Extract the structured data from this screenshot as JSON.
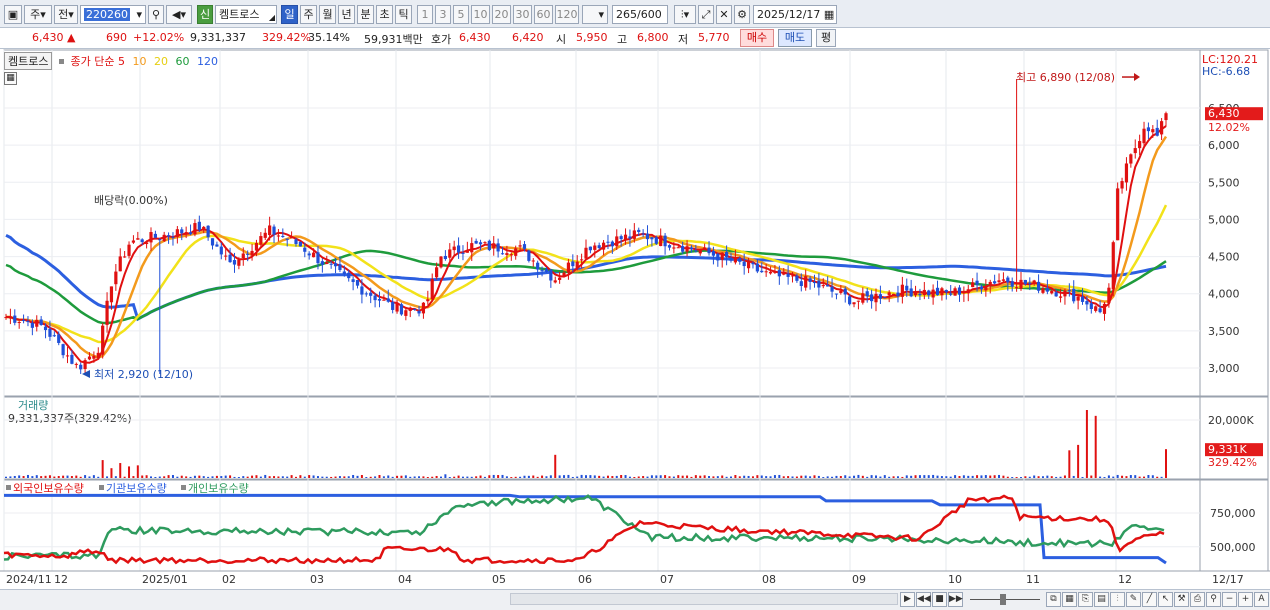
{
  "toolbar": {
    "period_label": "주",
    "prev_label": "전",
    "stock_code": "220260",
    "credit_badge": "신",
    "stock_name": "켐트로스",
    "tabs": [
      "일",
      "주",
      "월",
      "년",
      "분",
      "초",
      "틱"
    ],
    "active_tab": "일",
    "intervals": [
      "1",
      "3",
      "5",
      "10",
      "20",
      "30",
      "60",
      "120"
    ],
    "count": "265",
    "count_total": "/600",
    "date": "2025/12/17"
  },
  "quote": {
    "price": "6,430",
    "change": "690",
    "change_pct": "+12.02%",
    "volume": "9,331,337",
    "volume_ratio": "329.42%",
    "turnover": "35.14%",
    "amount": "59,931백만",
    "ask_label": "호가",
    "ask": "6,430",
    "bid": "6,420",
    "open_label": "시",
    "open": "5,950",
    "high_label": "고",
    "high": "6,800",
    "low_label": "저",
    "low": "5,770",
    "buy_label": "매수",
    "sell_label": "매도",
    "eval_label": "평"
  },
  "legend": {
    "stock_name": "켐트로스",
    "ma_title": "종가 단순",
    "ma_periods": [
      "5",
      "10",
      "20",
      "60",
      "120"
    ],
    "lc": "LC:120.21",
    "hc": "HC:-6.68",
    "dividend": "배당락(0.00%)",
    "high_note": "최고 6,890 (12/08)",
    "low_note": "최저 2,920 (12/10)",
    "last_price": "6,430",
    "last_pct": "12.02%",
    "volume_title": "거래량",
    "volume_value": "9,331,337주(329.42%)",
    "vol_last": "9,331K",
    "vol_last_pct": "329.42%",
    "holder_labels": [
      "외국인보유수량",
      "기관보유수량",
      "개인보유수량"
    ]
  },
  "axes": {
    "price_ticks": [
      "6,500",
      "6,000",
      "5,500",
      "5,000",
      "4,500",
      "4,000",
      "3,500",
      "3,000"
    ],
    "volume_ticks": [
      "20,000K"
    ],
    "holder_ticks": [
      "750,000",
      "500,000"
    ],
    "x_labels": [
      "2024/11",
      "12",
      "2025/01",
      "02",
      "03",
      "04",
      "05",
      "06",
      "07",
      "08",
      "09",
      "10",
      "11",
      "12",
      "12/17"
    ]
  },
  "colors": {
    "up": "#e01010",
    "down": "#1f4fd8",
    "ma5": "#e01010",
    "ma10": "#f39a1c",
    "ma20": "#f2e21a",
    "ma60": "#1e9b3c",
    "ma120": "#2c5fe0",
    "foreign": "#e01010",
    "institution": "#2c5fe0",
    "individual": "#2e9b5e"
  },
  "chart_data": [
    {
      "type": "candlestick",
      "title": "켐트로스 (220260) 일봉",
      "series": [
        {
          "name": "종가",
          "color": "#e01010",
          "points": [
            [
              "2024/11",
              3700
            ],
            [
              "12",
              3550
            ],
            [
              "2024/12/10",
              2920
            ],
            [
              "2025/01",
              4700
            ],
            [
              "02",
              4600
            ],
            [
              "03",
              4450
            ],
            [
              "04",
              3750
            ],
            [
              "05",
              4550
            ],
            [
              "06",
              4300
            ],
            [
              "07",
              4700
            ],
            [
              "08",
              4200
            ],
            [
              "09",
              3900
            ],
            [
              "10",
              4150
            ],
            [
              "11",
              4000
            ],
            [
              "2025/12/08",
              6890
            ],
            [
              "2025/12/17",
              6430
            ]
          ]
        },
        {
          "name": "5",
          "color": "#e01010"
        },
        {
          "name": "10",
          "color": "#f39a1c"
        },
        {
          "name": "20",
          "color": "#f2e21a"
        },
        {
          "name": "60",
          "color": "#1e9b3c"
        },
        {
          "name": "120",
          "color": "#2c5fe0"
        }
      ],
      "ylim": [
        2800,
        7000
      ],
      "annotations": [
        "최고 6,890 (12/08)",
        "최저 2,920 (12/10)",
        "배당락(0.00%)"
      ],
      "last_price": 6430
    },
    {
      "type": "bar",
      "title": "거래량",
      "series": [
        {
          "name": "거래량",
          "color": "#e01010",
          "points": [
            [
              "2024/12",
              5500
            ],
            [
              "2025/01",
              4000
            ],
            [
              "04",
              2500
            ],
            [
              "05",
              7500
            ],
            [
              "12",
              22000
            ],
            [
              "12/17",
              9331
            ]
          ]
        }
      ],
      "ylim": [
        0,
        22000
      ],
      "last_value": 9331
    },
    {
      "type": "line",
      "title": "보유수량",
      "series": [
        {
          "name": "외국인보유수량",
          "color": "#e01010"
        },
        {
          "name": "기관보유수량",
          "color": "#2c5fe0"
        },
        {
          "name": "개인보유수량",
          "color": "#2e9b5e"
        }
      ],
      "ylim": [
        350000,
        950000
      ]
    }
  ]
}
